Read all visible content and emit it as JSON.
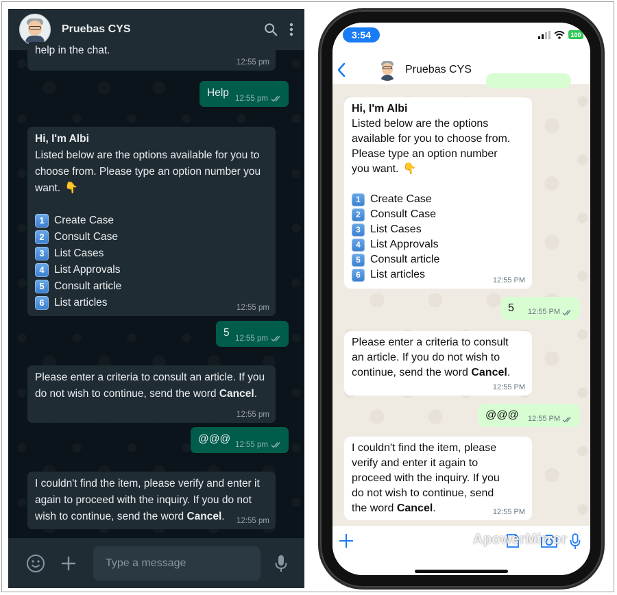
{
  "contact": {
    "name": "Pruebas CYS"
  },
  "left": {
    "input_placeholder": "Type a message",
    "messages": [
      {
        "text": "help in the chat.",
        "time": "12:55 pm"
      },
      {
        "text": "Help",
        "time": "12:55 pm"
      },
      {
        "greeting": "Hi, I'm Albi",
        "body_1": "Listed below are the options available for you to",
        "body_2": "choose from. Please type an option number you",
        "body_3": "want.",
        "time": "12:55 pm"
      },
      {
        "text": "5",
        "time": "12:55 pm"
      },
      {
        "line_1": "Please enter a criteria to consult an article. If you",
        "line_2": "do not wish to continue, send the word",
        "bold": "Cancel",
        "end": ".",
        "time": "12:55 pm"
      },
      {
        "text": "@@@",
        "time": "12:55 pm"
      },
      {
        "line_1": "I couldn't find the item, please verify and enter it",
        "line_2": "again to proceed with the inquiry. If you do not",
        "line_3": "wish to continue, send the word",
        "bold": "Cancel",
        "end": ".",
        "time": "12:55 pm"
      }
    ]
  },
  "options": [
    {
      "key": "1",
      "label": "Create Case"
    },
    {
      "key": "2",
      "label": "Consult Case"
    },
    {
      "key": "3",
      "label": "List Cases"
    },
    {
      "key": "4",
      "label": "List Approvals"
    },
    {
      "key": "5",
      "label": "Consult article"
    },
    {
      "key": "6",
      "label": "List articles"
    }
  ],
  "right": {
    "status_time": "3:54",
    "battery": "100",
    "watermark": "ApowerMirror",
    "messages": [
      {
        "greeting": "Hi, I'm Albi",
        "body_1": "Listed below are the options",
        "body_2": "available for you to choose from.",
        "body_3": "Please type an option number",
        "body_4": "you want.",
        "time": "12:55 PM"
      },
      {
        "text": "5",
        "time": "12:55 PM"
      },
      {
        "line_1": "Please enter a criteria to consult",
        "line_2": "an article. If you do not wish to",
        "line_3": "continue, send the word",
        "bold": "Cancel",
        "end": ".",
        "time": "12:55 PM"
      },
      {
        "text": "@@@",
        "time": "12:55 PM"
      },
      {
        "line_1": "I couldn't find the item, please",
        "line_2": "verify and enter it again to",
        "line_3": "proceed with the inquiry. If you",
        "line_4": "do not wish to continue, send",
        "line_5": "the word",
        "bold": "Cancel",
        "end": ".",
        "time": "12:55 PM"
      }
    ]
  },
  "colors": {
    "dark_bg": "#0b141a",
    "dark_incoming": "#202c33",
    "dark_outgoing": "#005c4b",
    "ios_outgoing": "#d9fdd3",
    "ios_accent": "#1a7cf5"
  },
  "icons": [
    "search-icon",
    "menu-icon",
    "emoji-icon",
    "plus-icon",
    "mic-icon",
    "back-chevron-icon",
    "camera-icon",
    "sticker-icon",
    "double-check-icon",
    "pointing-down-icon",
    "signal-icon",
    "wifi-icon"
  ]
}
